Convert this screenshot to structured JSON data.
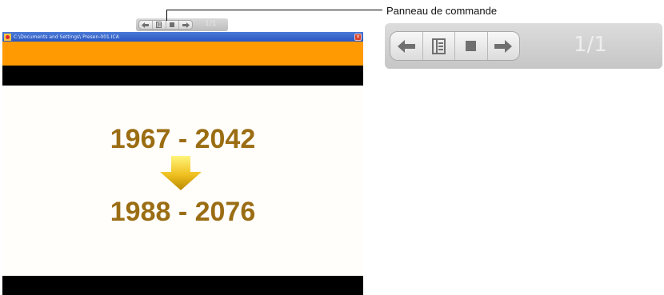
{
  "callout": {
    "label": "Panneau de commande"
  },
  "control_panel": {
    "buttons": [
      {
        "name": "previous",
        "icon": "arrow-left-icon"
      },
      {
        "name": "slide-list",
        "icon": "list-icon"
      },
      {
        "name": "stop",
        "icon": "stop-icon"
      },
      {
        "name": "next",
        "icon": "arrow-right-icon"
      }
    ],
    "page_indicator": "1/1"
  },
  "window": {
    "title": "C:\\Documents and Settings\\                              Presen-001.ICA",
    "close_glyph": "×"
  },
  "slide": {
    "line1": "1967 - 2042",
    "line2": "1988 - 2076"
  },
  "colors": {
    "accent_orange": "#ff9a02",
    "year_text": "#9b6d13",
    "arrow_top": "#fff070",
    "arrow_bottom": "#b88a00"
  }
}
